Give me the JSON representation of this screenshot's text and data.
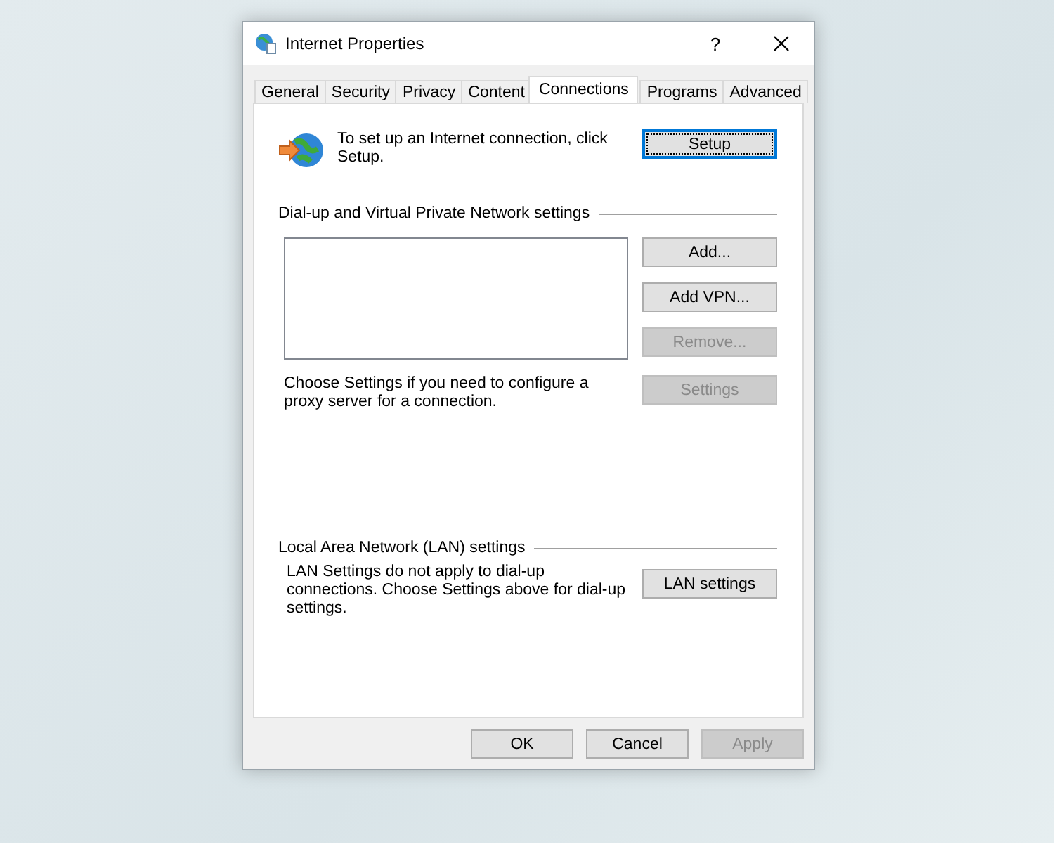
{
  "window": {
    "title": "Internet Properties",
    "help": "?"
  },
  "tabs": [
    {
      "label": "General",
      "selected": false
    },
    {
      "label": "Security",
      "selected": false
    },
    {
      "label": "Privacy",
      "selected": false
    },
    {
      "label": "Content",
      "selected": false
    },
    {
      "label": "Connections",
      "selected": true
    },
    {
      "label": "Programs",
      "selected": false
    },
    {
      "label": "Advanced",
      "selected": false
    }
  ],
  "setup": {
    "text": "To set up an Internet connection, click Setup.",
    "button": {
      "label": "Setup",
      "focused": true
    }
  },
  "dialup": {
    "heading": "Dial-up and Virtual Private Network settings",
    "buttons": [
      {
        "label": "Add...",
        "disabled": false
      },
      {
        "label": "Add VPN...",
        "disabled": false
      },
      {
        "label": "Remove...",
        "disabled": true
      }
    ],
    "note": "Choose Settings if you need to configure a proxy server for a connection.",
    "settings_button": {
      "label": "Settings",
      "disabled": true
    }
  },
  "lan": {
    "heading": "Local Area Network (LAN) settings",
    "note": "LAN Settings do not apply to dial-up connections. Choose Settings above for dial-up settings.",
    "button": {
      "label": "LAN settings",
      "disabled": false
    }
  },
  "footer_buttons": [
    {
      "label": "OK",
      "disabled": false
    },
    {
      "label": "Cancel",
      "disabled": false
    },
    {
      "label": "Apply",
      "disabled": true
    }
  ]
}
